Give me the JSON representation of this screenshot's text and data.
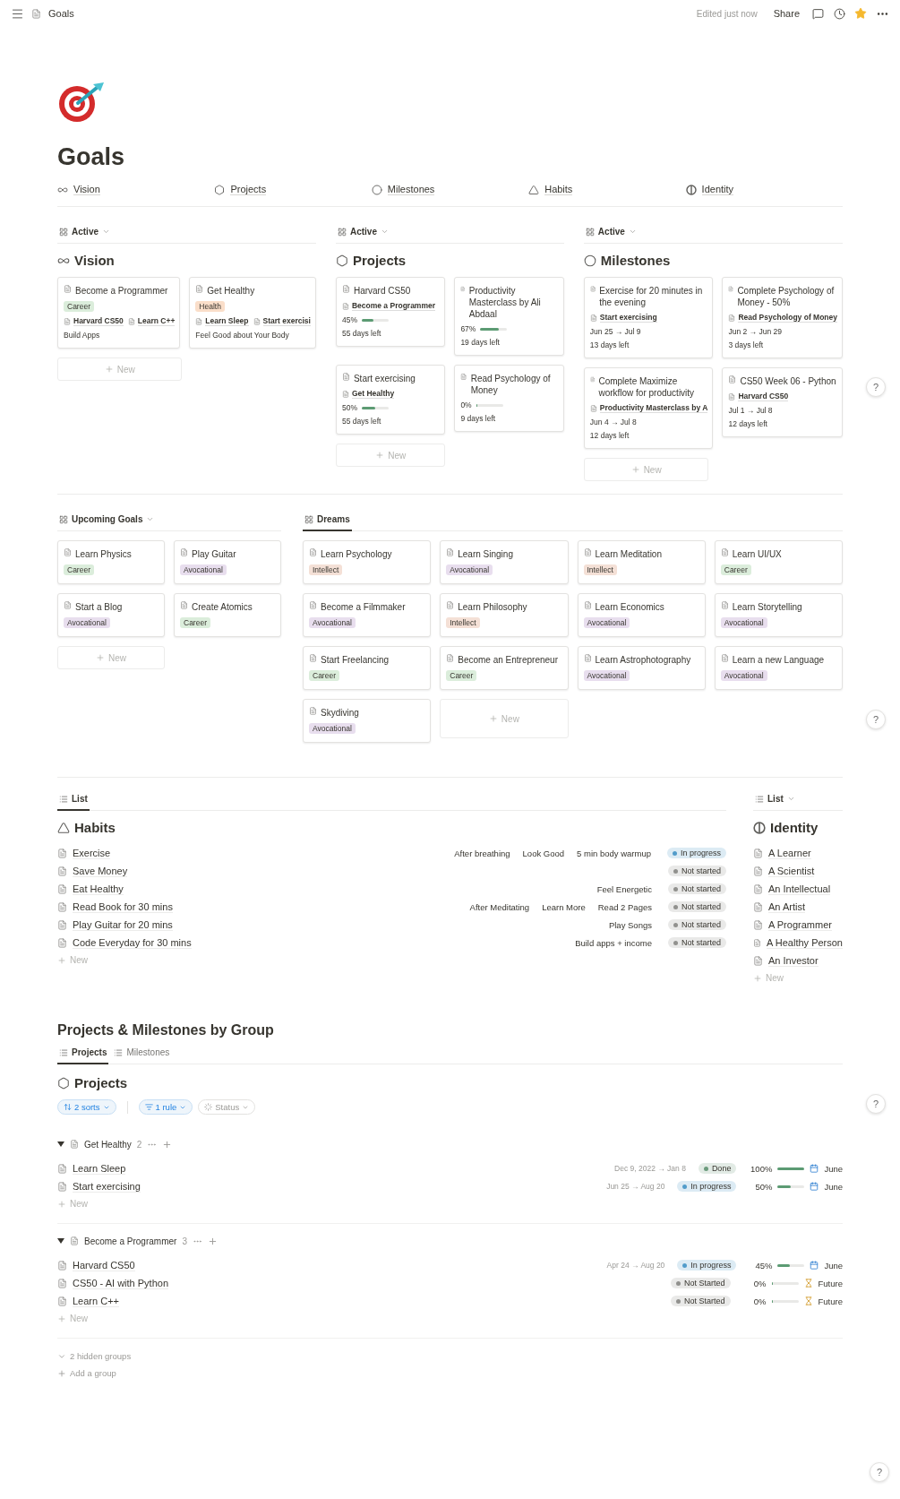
{
  "topbar": {
    "breadcrumb": "Goals",
    "edited": "Edited just now",
    "share": "Share",
    "favorite": true
  },
  "title": "Goals",
  "nav": [
    {
      "label": "Vision",
      "kind": "vision"
    },
    {
      "label": "Projects",
      "kind": "projects"
    },
    {
      "label": "Milestones",
      "kind": "milestones"
    },
    {
      "label": "Habits",
      "kind": "habits"
    },
    {
      "label": "Identity",
      "kind": "identity"
    }
  ],
  "boards": [
    {
      "view": "Active",
      "title": "Vision",
      "kind": "vision",
      "add": "New",
      "cards": [
        {
          "title": "Become a Programmer",
          "tags": [
            {
              "label": "Career",
              "color": "#dbeddb"
            }
          ],
          "relations": [
            "Harvard CS50",
            "Learn C++"
          ],
          "lines": [
            "Build Apps"
          ]
        },
        {
          "title": "Get Healthy",
          "tags": [
            {
              "label": "Health",
              "color": "#fadec9"
            }
          ],
          "relations": [
            "Learn Sleep",
            "Start exercisi"
          ],
          "lines": [
            "Feel Good about Your Body"
          ]
        }
      ]
    },
    {
      "view": "Active",
      "title": "Projects",
      "kind": "projects",
      "add": "New",
      "cards": [
        {
          "title": "Harvard CS50",
          "relations": [
            "Become a Programmer"
          ],
          "progress": {
            "reading": "45%",
            "level": 0.45
          },
          "lines": [
            "55 days left"
          ]
        },
        {
          "title": "Productivity Masterclass by Ali Abdaal",
          "progress": {
            "reading": "67%",
            "level": 0.67
          },
          "lines": [
            "19 days left"
          ]
        },
        {
          "title": "Start exercising",
          "relations": [
            "Get Healthy"
          ],
          "progress": {
            "reading": "50%",
            "level": 0.5
          },
          "lines": [
            "55 days left"
          ]
        },
        {
          "title": "Read Psychology of Money",
          "progress": {
            "reading": "0%",
            "level": 0
          },
          "lines": [
            "9 days left"
          ]
        }
      ]
    },
    {
      "view": "Active",
      "title": "Milestones",
      "kind": "milestones",
      "add": "New",
      "cards": [
        {
          "title": "Exercise for 20 minutes in the evening",
          "relations": [
            "Start exercising"
          ],
          "lines": [
            "Jun 25 → Jul 9",
            "13 days left"
          ]
        },
        {
          "title": "Complete Psychology of Money - 50%",
          "relations": [
            "Read Psychology of Money"
          ],
          "lines": [
            "Jun 2 → Jun 29",
            "3 days left"
          ]
        },
        {
          "title": "Complete Maximize workflow for productivity",
          "relations": [
            "Productivity Masterclass by A"
          ],
          "lines": [
            "Jun 4 → Jul 8",
            "12 days left"
          ]
        },
        {
          "title": "CS50 Week 06 - Python",
          "relations": [
            "Harvard CS50"
          ],
          "lines": [
            "Jul 1 → Jul 8",
            "12 days left"
          ]
        }
      ]
    }
  ],
  "upcoming": {
    "view": "Upcoming Goals",
    "add": "New",
    "cards": [
      {
        "title": "Learn Physics",
        "tags": [
          {
            "label": "Career",
            "color": "#dbeddb"
          }
        ]
      },
      {
        "title": "Play Guitar",
        "tags": [
          {
            "label": "Avocational",
            "color": "#e8deee"
          }
        ]
      },
      {
        "title": "Start a Blog",
        "tags": [
          {
            "label": "Avocational",
            "color": "#e8deee"
          }
        ]
      },
      {
        "title": "Create Atomics",
        "tags": [
          {
            "label": "Career",
            "color": "#dbeddb"
          }
        ]
      }
    ]
  },
  "dreams": {
    "tab": "Dreams",
    "add": "New",
    "cards": [
      {
        "title": "Learn Psychology",
        "tags": [
          {
            "label": "Intellect",
            "color": "#f4e0d6"
          }
        ]
      },
      {
        "title": "Learn Singing",
        "tags": [
          {
            "label": "Avocational",
            "color": "#e8deee"
          }
        ]
      },
      {
        "title": "Learn Meditation",
        "tags": [
          {
            "label": "Intellect",
            "color": "#f4e0d6"
          }
        ]
      },
      {
        "title": "Learn UI/UX",
        "tags": [
          {
            "label": "Career",
            "color": "#dbeddb"
          }
        ]
      },
      {
        "title": "Become a Filmmaker",
        "tags": [
          {
            "label": "Avocational",
            "color": "#e8deee"
          }
        ]
      },
      {
        "title": "Learn Philosophy",
        "tags": [
          {
            "label": "Intellect",
            "color": "#f4e0d6"
          }
        ]
      },
      {
        "title": "Learn Economics",
        "tags": [
          {
            "label": "Avocational",
            "color": "#e8deee"
          }
        ]
      },
      {
        "title": "Learn Storytelling",
        "tags": [
          {
            "label": "Avocational",
            "color": "#e8deee"
          }
        ]
      },
      {
        "title": "Start Freelancing",
        "tags": [
          {
            "label": "Career",
            "color": "#dbeddb"
          }
        ]
      },
      {
        "title": "Become an Entrepreneur",
        "tags": [
          {
            "label": "Career",
            "color": "#dbeddb"
          }
        ]
      },
      {
        "title": "Learn Astrophotography",
        "tags": [
          {
            "label": "Avocational",
            "color": "#e8deee"
          }
        ]
      },
      {
        "title": "Learn a new Language",
        "tags": [
          {
            "label": "Avocational",
            "color": "#e8deee"
          }
        ]
      },
      {
        "title": "Skydiving",
        "tags": [
          {
            "label": "Avocational",
            "color": "#e8deee"
          }
        ]
      }
    ]
  },
  "habits": {
    "tab": "List",
    "title": "Habits",
    "add": "New",
    "rows": [
      {
        "name": "Exercise",
        "props": [
          "After breathing",
          "Look Good",
          "5 min body warmup"
        ],
        "status": {
          "label": "In progress",
          "color": "#529cca"
        }
      },
      {
        "name": "Save Money",
        "props": [],
        "status": {
          "label": "Not started",
          "color": "#91918e"
        }
      },
      {
        "name": "Eat Healthy",
        "props": [
          "Feel Energetic"
        ],
        "status": {
          "label": "Not started",
          "color": "#91918e"
        }
      },
      {
        "name": "Read Book for 30 mins",
        "props": [
          "After Meditating",
          "Learn More",
          "Read 2 Pages"
        ],
        "status": {
          "label": "Not started",
          "color": "#91918e"
        }
      },
      {
        "name": "Play Guitar for 20 mins",
        "props": [
          "Play Songs"
        ],
        "status": {
          "label": "Not started",
          "color": "#91918e"
        }
      },
      {
        "name": "Code Everyday for 30 mins",
        "props": [
          "Build apps + income"
        ],
        "status": {
          "label": "Not started",
          "color": "#91918e"
        }
      }
    ]
  },
  "identity": {
    "view": "List",
    "title": "Identity",
    "add": "New",
    "items": [
      "A Learner",
      "A Scientist",
      "An Intellectual",
      "An Artist",
      "A Programmer",
      "A Healthy Person",
      "An Investor"
    ]
  },
  "by_group": {
    "title": "Projects & Milestones by Group",
    "tabs": [
      {
        "label": "Projects",
        "selected": true
      },
      {
        "label": "Milestones",
        "selected": false
      }
    ],
    "heading": "Projects",
    "filters": [
      {
        "label": "2 sorts",
        "kind": "sort",
        "active": true
      },
      {
        "label": "1 rule",
        "kind": "filter",
        "active": true
      },
      {
        "label": "Status",
        "kind": "status",
        "active": false
      }
    ],
    "groups": [
      {
        "title": "Get Healthy",
        "count": "2",
        "expanded": true,
        "add": "New",
        "rows": [
          {
            "name": "Learn Sleep",
            "dates": "Dec 9, 2022 → Jan 8",
            "status": {
              "label": "Done",
              "color": "#6c9b7d"
            },
            "percent": "100%",
            "level": 1,
            "due": {
              "label": "June",
              "kind": "calendar"
            }
          },
          {
            "name": "Start exercising",
            "dates": "Jun 25 → Aug 20",
            "status": {
              "label": "In progress",
              "color": "#529cca"
            },
            "percent": "50%",
            "level": 0.5,
            "due": {
              "label": "June",
              "kind": "calendar"
            }
          }
        ]
      },
      {
        "title": "Become a Programmer",
        "count": "3",
        "expanded": true,
        "add": "New",
        "rows": [
          {
            "name": "Harvard CS50",
            "dates": "Apr 24 → Aug 20",
            "status": {
              "label": "In progress",
              "color": "#529cca"
            },
            "percent": "45%",
            "level": 0.45,
            "due": {
              "label": "June",
              "kind": "calendar"
            }
          },
          {
            "name": "CS50 - AI with Python",
            "status": {
              "label": "Not Started",
              "color": "#91918e"
            },
            "percent": "0%",
            "level": 0,
            "due": {
              "label": "Future",
              "kind": "hourglass"
            }
          },
          {
            "name": "Learn C++",
            "status": {
              "label": "Not Started",
              "color": "#91918e"
            },
            "percent": "0%",
            "level": 0,
            "due": {
              "label": "Future",
              "kind": "hourglass"
            }
          }
        ]
      }
    ],
    "hidden": "2 hidden groups",
    "add_group": "Add a group"
  },
  "help": [
    "?",
    "?",
    "?",
    "?"
  ]
}
